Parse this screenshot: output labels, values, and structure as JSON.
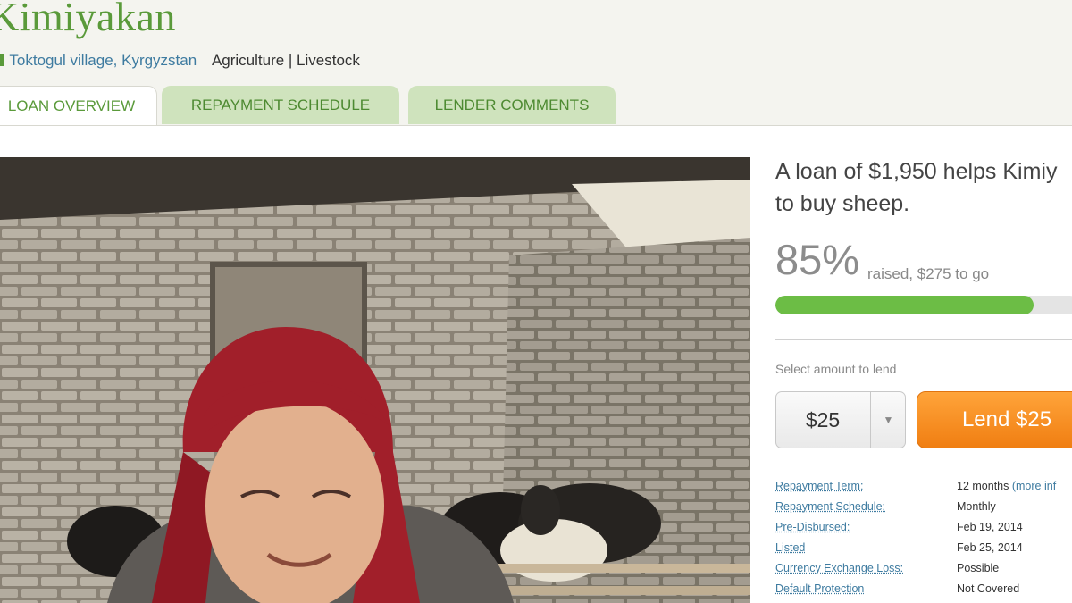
{
  "borrower": {
    "name": "Kimiyakan",
    "location": "Toktogul village, Kyrgyzstan",
    "sector": "Agriculture | Livestock"
  },
  "tabs": [
    {
      "label": "LOAN OVERVIEW",
      "active": true
    },
    {
      "label": "REPAYMENT SCHEDULE",
      "active": false
    },
    {
      "label": "LENDER COMMENTS",
      "active": false
    }
  ],
  "photo": {
    "icon": "borrower-photo"
  },
  "loan": {
    "headline_line1": "A loan of $1,950 helps Kimiy",
    "headline_line2": "to buy sheep.",
    "percent_text": "85%",
    "percent_value": 85,
    "raised_text": "raised, $275 to go",
    "select_label": "Select amount to lend",
    "amount_value": "$25",
    "lend_label": "Lend $25"
  },
  "details": [
    {
      "key": "Repayment Term:",
      "value": "12 months",
      "extra": " (more inf"
    },
    {
      "key": "Repayment Schedule:",
      "value": "Monthly"
    },
    {
      "key": "Pre-Disbursed:",
      "value": "Feb 19, 2014"
    },
    {
      "key": "Listed",
      "value": "Feb 25, 2014"
    },
    {
      "key": "Currency Exchange Loss:",
      "value": "Possible"
    },
    {
      "key": "Default Protection",
      "value": "Not Covered"
    }
  ],
  "colors": {
    "brand_green": "#5a9a3a",
    "progress": "#6cbd45",
    "lend_button": "#f7901e",
    "link": "#3e7ba0"
  }
}
